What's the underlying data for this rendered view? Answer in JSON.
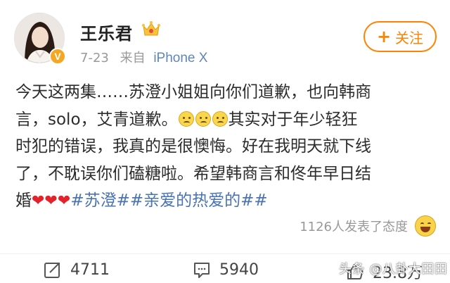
{
  "post": {
    "author": "王乐君",
    "date": "7-23",
    "source_prefix": "来自",
    "device": "iPhone X",
    "follow_label": "关注",
    "follow_plus": "+",
    "verified_mark": "V",
    "content": {
      "line1": "今天这两集……苏澄小姐姐向你们道歉，也向韩商",
      "line2a": "言，solo，艾青道歉。",
      "line2b": "其实对于年少轻狂",
      "line3": "时犯的错误，我真的是很懊悔。好在我明天就下线",
      "line4": "了，不耽误你们磕糖啦。希望韩商言和佟年早日结",
      "line5a": "婚",
      "hearts": "❤❤❤",
      "tags": "#苏澄##亲爱的热爱的#",
      "tail": "#"
    },
    "reactions": "1126人发表了态度"
  },
  "footer": {
    "repost_count": "4711",
    "comment_count": "5940",
    "like_count": "23.8万"
  },
  "watermark": "头条 @八卦大田田",
  "colors": {
    "follow": "#ff8200",
    "link": "#4a73b3",
    "device": "#5f86b4",
    "heart": "#e2232b",
    "verified": "#f5a623"
  },
  "icons": [
    "crown-icon",
    "verified-badge-icon",
    "rolling-eyes-emoji",
    "heart-emoji",
    "laughing-emoji",
    "repost-icon",
    "comment-icon",
    "like-icon"
  ]
}
